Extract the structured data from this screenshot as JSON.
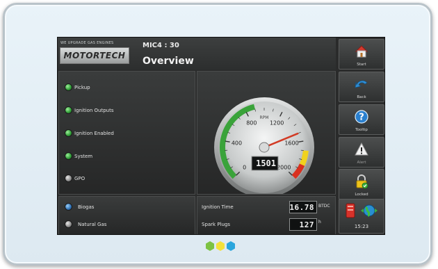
{
  "brand": {
    "tagline": "WE UPGRADE GAS ENGINES",
    "logo_text": "MOTORTECH"
  },
  "header": {
    "device_id": "MIC4 : 30",
    "title": "Overview"
  },
  "status_leds": [
    {
      "label": "Pickup",
      "color": "green"
    },
    {
      "label": "Ignition Outputs",
      "color": "green"
    },
    {
      "label": "Ignition Enabled",
      "color": "green"
    },
    {
      "label": "System",
      "color": "green"
    },
    {
      "label": "GPO",
      "color": "grey"
    }
  ],
  "gauge": {
    "unit": "RPM",
    "ticks": [
      "0",
      "400",
      "800",
      "1200",
      "1600",
      "2000"
    ],
    "min": 0,
    "max": 2000,
    "value": 1501,
    "display": "1501",
    "zones": {
      "green": [
        0,
        900
      ],
      "yellow": [
        1700,
        1850
      ],
      "red": [
        1850,
        2000
      ]
    }
  },
  "fuel": [
    {
      "label": "Biogas",
      "color": "blue"
    },
    {
      "label": "Natural Gas",
      "color": "grey"
    }
  ],
  "info": {
    "ignition_time_label": "Ignition Time",
    "ignition_time_value": "16.78",
    "ignition_time_unit": "BTDC",
    "spark_plugs_label": "Spark Plugs",
    "spark_plugs_value": "127",
    "spark_plugs_unit": "h"
  },
  "sidebar": {
    "buttons": [
      {
        "label": "Start",
        "icon": "house-icon"
      },
      {
        "label": "Back",
        "icon": "back-arrow-icon"
      },
      {
        "label": "Tooltip",
        "icon": "help-icon"
      },
      {
        "label": "Alert",
        "icon": "warning-icon"
      },
      {
        "label": "Locked",
        "icon": "lock-icon"
      }
    ],
    "clock": "15:23"
  },
  "indicator_dots": [
    "#7cc243",
    "#f4e13b",
    "#2aa6dd"
  ]
}
